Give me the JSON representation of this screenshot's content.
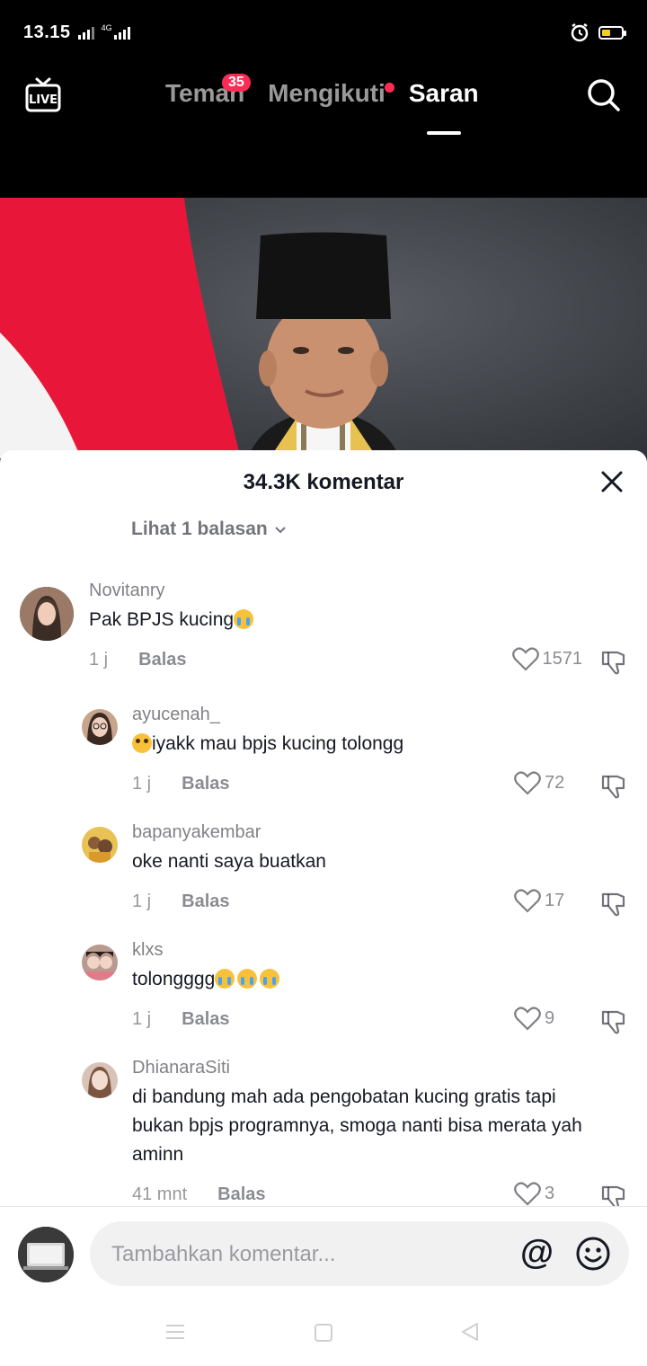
{
  "status_bar": {
    "time": "13.15",
    "network": "4G"
  },
  "nav": {
    "tabs": [
      {
        "label": "Teman",
        "badge": "35"
      },
      {
        "label": "Mengikuti"
      },
      {
        "label": "Saran"
      }
    ],
    "active_tab": "Saran",
    "live_label": "LIVE"
  },
  "comments_sheet": {
    "title": "34.3K komentar",
    "view_replies": "Lihat 1 balasan",
    "comments": [
      {
        "user": "Novitanry",
        "text": "Pak BPJS kucing",
        "emoji": "crying-face",
        "time": "1 j",
        "reply_label": "Balas",
        "likes": "1571"
      },
      {
        "user": "ayucenah_",
        "text": "iyakk mau bpjs kucing tolongg",
        "emoji": "pleading-face",
        "time": "1 j",
        "reply_label": "Balas",
        "likes": "72"
      },
      {
        "user": "bapanyakembar",
        "text": "oke nanti saya buatkan",
        "time": "1 j",
        "reply_label": "Balas",
        "likes": "17"
      },
      {
        "user": "klxs",
        "text": "tolongggg",
        "emoji": "crying-face x3",
        "time": "1 j",
        "reply_label": "Balas",
        "likes": "9"
      },
      {
        "user": "DhianaraSiti",
        "text_lines": [
          "di bandung mah ada pengobatan kucing gratis tapi",
          "bukan bpjs programnya, smoga nanti bisa merata yah",
          "aminn"
        ],
        "time": "41 mnt",
        "reply_label": "Balas",
        "likes": "3"
      }
    ]
  },
  "input": {
    "placeholder": "Tambahkan komentar...",
    "mention_symbol": "@"
  },
  "colors": {
    "accent": "#fe2c55",
    "top_bar": "#000000",
    "sheet": "#ffffff"
  }
}
